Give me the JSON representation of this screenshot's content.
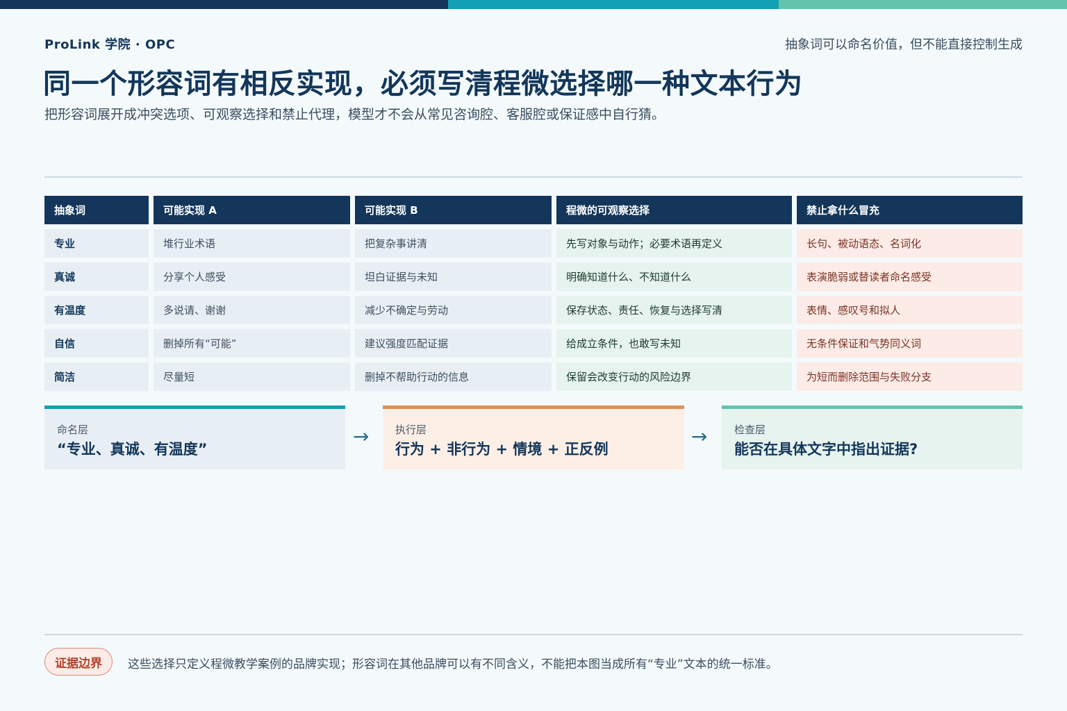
{
  "header": {
    "brand": "ProLink 学院 · OPC",
    "note": "抽象词可以命名价值，但不能直接控制生成",
    "title": "同一个形容词有相反实现，必须写清程微选择哪一种文本行为",
    "subtitle": "把形容词展开成冲突选项、可观察选择和禁止代理，模型才不会从常见咨询腔、客服腔或保证感中自行猜。"
  },
  "table": {
    "headers": [
      "抽象词",
      "可能实现 A",
      "可能实现 B",
      "程微的可观察选择",
      "禁止拿什么冒充"
    ],
    "rows": [
      [
        "专业",
        "堆行业术语",
        "把复杂事讲清",
        "先写对象与动作；必要术语再定义",
        "长句、被动语态、名词化"
      ],
      [
        "真诚",
        "分享个人感受",
        "坦白证据与未知",
        "明确知道什么、不知道什么",
        "表演脆弱或替读者命名感受"
      ],
      [
        "有温度",
        "多说请、谢谢",
        "减少不确定与劳动",
        "保存状态、责任、恢复与选择写清",
        "表情、感叹号和拟人"
      ],
      [
        "自信",
        "删掉所有“可能”",
        "建议强度匹配证据",
        "给成立条件，也敢写未知",
        "无条件保证和气势同义词"
      ],
      [
        "简洁",
        "尽量短",
        "删掉不帮助行动的信息",
        "保留会改变行动的风险边界",
        "为短而删除范围与失败分支"
      ]
    ]
  },
  "flow": {
    "cards": [
      {
        "label": "命名层",
        "value": "“专业、真诚、有温度”"
      },
      {
        "label": "执行层",
        "value": "行为 + 非行为 + 情境 + 正反例"
      },
      {
        "label": "检查层",
        "value": "能否在具体文字中指出证据?"
      }
    ],
    "arrow": "→"
  },
  "footer": {
    "tag": "证据边界",
    "note": "这些选择只定义程微教学案例的品牌实现；形容词在其他品牌可以有不同含义，不能把本图当成所有“专业”文本的统一标准。"
  },
  "colors": {
    "navy": "#13365a",
    "teal": "#12a0b5",
    "mint": "#63c4ae",
    "orange": "#e09050",
    "red": "#b4402c"
  }
}
